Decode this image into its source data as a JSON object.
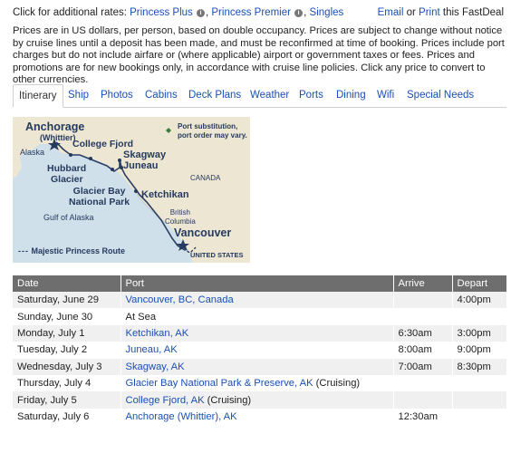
{
  "top": {
    "lead": "Click for additional rates:",
    "rates": [
      {
        "label": "Princess Plus"
      },
      {
        "label": "Princess Premier"
      },
      {
        "label": "Singles"
      }
    ],
    "info_glyph": "i",
    "email": "Email",
    "or": "or",
    "print": "Print",
    "tail": "this FastDeal"
  },
  "notice": "Prices are in US dollars, per person, based on double occupancy. Prices are subject to change without notice by cruise lines until a deposit has been made, and must be reconfirmed at time of booking. Prices include port charges but do not include airfare or (where applicable) airport or government taxes or fees. Prices and promotions are for new bookings only, in accordance with cruise line policies. Click any price to convert to other currencies.",
  "tabs": [
    "Itinerary",
    "Ship",
    "Photos",
    "Cabins",
    "Deck Plans",
    "Weather",
    "Ports",
    "Dining",
    "Wifi",
    "Special Needs"
  ],
  "map": {
    "anchorage": "Anchorage",
    "whittier": "(Whittier)",
    "college_fjord": "College Fjord",
    "alaska": "Alaska",
    "hubbard1": "Hubbard",
    "hubbard2": "Glacier",
    "glacier1": "Glacier Bay",
    "glacier2": "National Park",
    "skagway": "Skagway",
    "juneau": "Juneau",
    "canada": "CANADA",
    "ketchikan": "Ketchikan",
    "gulf": "Gulf of Alaska",
    "bc1": "British",
    "bc2": "Columbia",
    "vancouver": "Vancouver",
    "us": "UNITED STATES",
    "note1": "Port substitution,",
    "note2": "port order may vary.",
    "legend": "Majestic Princess Route",
    "colors": {
      "water": "#cfe0ea",
      "land": "#ece6d3",
      "text": "#263a5e",
      "route": "#2d3f63"
    }
  },
  "table": {
    "headers": [
      "Date",
      "Port",
      "Arrive",
      "Depart"
    ],
    "rows": [
      {
        "date": "Saturday, June 29",
        "port": "Vancouver, BC, Canada",
        "note": "",
        "link": true,
        "arrive": "",
        "depart": "4:00pm"
      },
      {
        "date": "Sunday, June 30",
        "port": "At Sea",
        "note": "",
        "link": false,
        "arrive": "",
        "depart": ""
      },
      {
        "date": "Monday, July 1",
        "port": "Ketchikan, AK",
        "note": "",
        "link": true,
        "arrive": "6:30am",
        "depart": "3:00pm"
      },
      {
        "date": "Tuesday, July 2",
        "port": "Juneau, AK",
        "note": "",
        "link": true,
        "arrive": "8:00am",
        "depart": "9:00pm"
      },
      {
        "date": "Wednesday, July 3",
        "port": "Skagway, AK",
        "note": "",
        "link": true,
        "arrive": "7:00am",
        "depart": "8:30pm"
      },
      {
        "date": "Thursday, July 4",
        "port": "Glacier Bay National Park & Preserve, AK",
        "note": " (Cruising)",
        "link": true,
        "arrive": "",
        "depart": ""
      },
      {
        "date": "Friday, July 5",
        "port": "College Fjord, AK",
        "note": " (Cruising)",
        "link": true,
        "arrive": "",
        "depart": ""
      },
      {
        "date": "Saturday, July 6",
        "port": "Anchorage (Whittier), AK",
        "note": "",
        "link": true,
        "arrive": "12:30am",
        "depart": ""
      }
    ]
  }
}
